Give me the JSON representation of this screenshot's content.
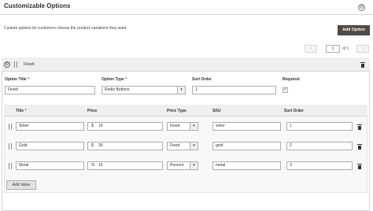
{
  "section": {
    "title": "Customizable Options",
    "intro": "Custom options let customers choose the product variations they want.",
    "add_option_label": "Add Option",
    "collapse_glyph": "⊖"
  },
  "pager": {
    "current_page": "1",
    "of_label": "of 1",
    "prev_glyph": "‹",
    "next_glyph": "›"
  },
  "option": {
    "name": "Finish",
    "toggle_glyph": "⊖",
    "fields": {
      "title_label": "Option Title",
      "title_value": "Finish",
      "type_label": "Option Type",
      "type_value": "Radio Buttons",
      "sort_label": "Sort Order",
      "sort_value": "1",
      "required_label": "Required",
      "required_checked": true,
      "check_glyph": "✓",
      "required_mark": "*"
    }
  },
  "values_table": {
    "columns": [
      "Title",
      "Price",
      "Price Type",
      "SKU",
      "Sort Order"
    ],
    "required_mark": "*",
    "rows": [
      {
        "title": "Silver",
        "price_prefix": "$",
        "price": "10",
        "price_type": "Fixed",
        "sku": "silver",
        "sort_order": "1"
      },
      {
        "title": "Gold",
        "price_prefix": "$",
        "price": "30",
        "price_type": "Fixed",
        "sku": "gold",
        "sort_order": "2"
      },
      {
        "title": "Metal",
        "price_prefix": "%",
        "price": "15",
        "price_type": "Percent",
        "sku": "metal",
        "sort_order": "3"
      }
    ],
    "add_value_label": "Add Value",
    "select_arrow_glyph": "▾"
  }
}
